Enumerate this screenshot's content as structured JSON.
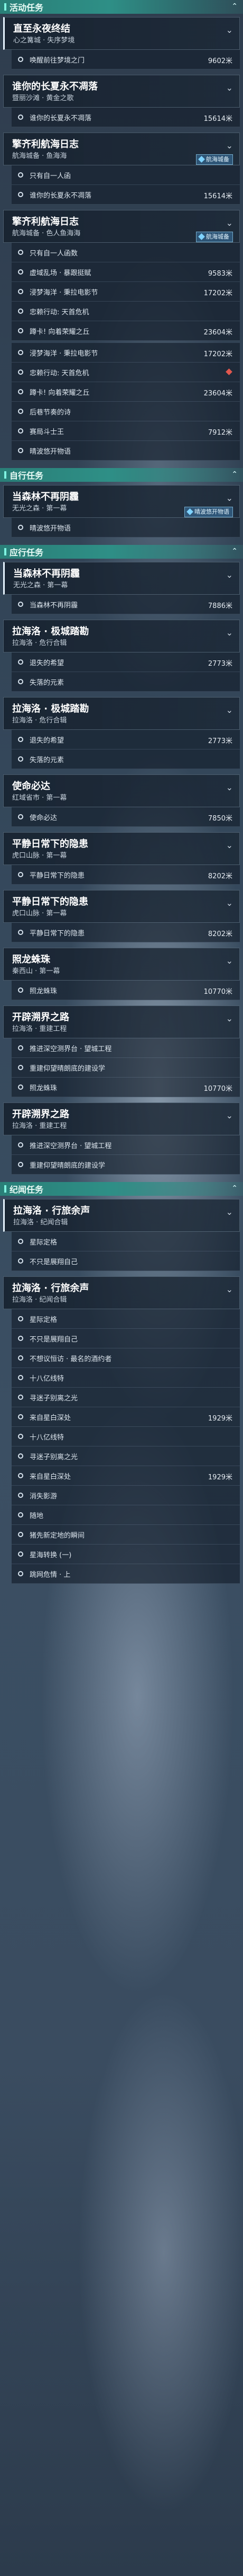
{
  "categories": {
    "activity": "活动任务",
    "self": "自行任务",
    "side": "应行任务",
    "legend": "纪闻任务"
  },
  "units": {
    "meter": "米"
  },
  "quests": [
    {
      "title": "直至永夜终结",
      "subtitle": "心之篝城 · 失序梦境",
      "badge": "",
      "steps": [
        {
          "label": "唤醒前往梦境之门",
          "dist": "9602米",
          "done": false,
          "marker": ""
        }
      ]
    },
    {
      "title": "谁你的长夏永不凋落",
      "subtitle": "暨丽沙滩 · 黄金之歌",
      "badge": "",
      "steps": [
        {
          "label": "谁你的长夏永不凋落",
          "dist": "15614米",
          "done": false,
          "marker": ""
        }
      ]
    },
    {
      "title": "擎齐利航海日志",
      "subtitle": "航海城备 · 鱼海海",
      "badge": "航海城备",
      "steps": [
        {
          "label": "只有自一人函",
          "dist": "",
          "done": false,
          "marker": ""
        },
        {
          "label": "谁你的长夏永不凋落",
          "dist": "15614米",
          "done": false,
          "marker": ""
        }
      ]
    },
    {
      "title": "擎齐利航海日志",
      "subtitle": "航海城备 · 色人鱼海海",
      "badge": "航海城备",
      "steps": [
        {
          "label": "只有自一人函数",
          "dist": "",
          "done": false,
          "marker": ""
        },
        {
          "label": "虚域乱场 · 暴跟挺赋",
          "dist": "9583米",
          "done": false,
          "marker": ""
        },
        {
          "label": "浸梦海洋 · 秉拉电影节",
          "dist": "17202米",
          "done": false,
          "marker": ""
        },
        {
          "label": "忠赖行动: 天首危机",
          "dist": "",
          "done": false,
          "marker": ""
        },
        {
          "label": "蹲卡! 向着荣耀之丘",
          "dist": "23604米",
          "done": false,
          "marker": ""
        }
      ]
    },
    {
      "title": "",
      "subtitle": "",
      "badge": "",
      "steps": [
        {
          "label": "浸梦海洋 · 秉拉电影节",
          "dist": "17202米",
          "done": false,
          "marker": ""
        },
        {
          "label": "忠赖行动: 天首危机",
          "dist": "",
          "done": false,
          "marker": "diamond"
        },
        {
          "label": "蹲卡! 向着荣耀之丘",
          "dist": "23604米",
          "done": false,
          "marker": ""
        },
        {
          "label": "后巷节奏的诗",
          "dist": "",
          "done": false,
          "marker": ""
        },
        {
          "label": "赛局斗士王",
          "dist": "7912米",
          "done": false,
          "marker": ""
        },
        {
          "label": "晴波悠开物语",
          "dist": "",
          "done": false,
          "marker": ""
        }
      ]
    },
    {
      "title": "当森林不再阴霾",
      "subtitle": "无光之森 · 第一幕",
      "badge": "晴波悠开物语",
      "steps": [
        {
          "label": "晴波悠开物语",
          "dist": "",
          "done": false,
          "marker": ""
        }
      ]
    },
    {
      "title": "当森林不再阴霾",
      "subtitle": "无光之森 · 第一幕",
      "badge": "",
      "steps": [
        {
          "label": "当森林不再阴霾",
          "dist": "7886米",
          "done": false,
          "marker": ""
        }
      ]
    },
    {
      "title": "拉海洛 · 极城踏勘",
      "subtitle": "拉海洛 · 危行合辑",
      "badge": "",
      "steps": [
        {
          "label": "退失的希望",
          "dist": "2773米",
          "done": false,
          "marker": ""
        },
        {
          "label": "失落的元素",
          "dist": "",
          "done": false,
          "marker": ""
        }
      ]
    },
    {
      "title": "拉海洛 · 极城踏勘",
      "subtitle": "拉海洛 · 危行合辑",
      "badge": "",
      "steps": [
        {
          "label": "退失的希望",
          "dist": "2773米",
          "done": false,
          "marker": ""
        },
        {
          "label": "失落的元素",
          "dist": "",
          "done": false,
          "marker": ""
        }
      ]
    },
    {
      "title": "使命必达",
      "subtitle": "红域省市 · 第一幕",
      "badge": "",
      "steps": [
        {
          "label": "使命必达",
          "dist": "7850米",
          "done": false,
          "marker": ""
        }
      ]
    },
    {
      "title": "平静日常下的隐患",
      "subtitle": "虎口山脉 · 第一幕",
      "badge": "",
      "steps": [
        {
          "label": "平静日常下的隐患",
          "dist": "8202米",
          "done": false,
          "marker": ""
        }
      ]
    },
    {
      "title": "平静日常下的隐患",
      "subtitle": "虎口山脉 · 第一幕",
      "badge": "",
      "steps": [
        {
          "label": "平静日常下的隐患",
          "dist": "8202米",
          "done": false,
          "marker": ""
        }
      ]
    },
    {
      "title": "照龙蛛珠",
      "subtitle": "秦西山 · 第一幕",
      "badge": "",
      "steps": [
        {
          "label": "照龙蛛珠",
          "dist": "10770米",
          "done": false,
          "marker": ""
        }
      ]
    },
    {
      "title": "开辟溯界之路",
      "subtitle": "拉海洛 · 重建工程",
      "badge": "",
      "steps": [
        {
          "label": "推进深空测界台 · 望城工程",
          "dist": "",
          "done": false,
          "marker": ""
        },
        {
          "label": "重建仰望晴朗底的建设学",
          "dist": "",
          "done": false,
          "marker": ""
        },
        {
          "label": "照龙蛛珠",
          "dist": "10770米",
          "done": false,
          "marker": ""
        }
      ]
    },
    {
      "title": "开辟溯界之路",
      "subtitle": "拉海洛 · 重建工程",
      "badge": "",
      "steps": [
        {
          "label": "推进深空测界台 · 望城工程",
          "dist": "",
          "done": false,
          "marker": ""
        },
        {
          "label": "重建仰望晴朗底的建设学",
          "dist": "",
          "done": false,
          "marker": ""
        }
      ]
    },
    {
      "title": "拉海洛 · 行旅余声",
      "subtitle": "拉海洛 · 纪闻合辑",
      "badge": "",
      "steps": [
        {
          "label": "星际定格",
          "dist": "",
          "done": false,
          "marker": ""
        },
        {
          "label": "不只是展翔自己",
          "dist": "",
          "done": false,
          "marker": ""
        }
      ]
    },
    {
      "title": "拉海洛 · 行旅余声",
      "subtitle": "拉海洛 · 纪闻合辑",
      "badge": "",
      "steps": [
        {
          "label": "星际定格",
          "dist": "",
          "done": false,
          "marker": ""
        },
        {
          "label": "不只是展翔自己",
          "dist": "",
          "done": false,
          "marker": ""
        },
        {
          "label": "不想议恒访 · 最名的酒约者",
          "dist": "",
          "done": false,
          "marker": ""
        },
        {
          "label": "十八亿线特",
          "dist": "",
          "done": false,
          "marker": ""
        },
        {
          "label": "寻迷子别离之光",
          "dist": "",
          "done": false,
          "marker": ""
        },
        {
          "label": "来自星白深处",
          "dist": "1929米",
          "done": false,
          "marker": ""
        },
        {
          "label": "十八亿线特",
          "dist": "",
          "done": false,
          "marker": ""
        },
        {
          "label": "寻迷子别离之光",
          "dist": "",
          "done": false,
          "marker": ""
        },
        {
          "label": "来自星白深处",
          "dist": "1929米",
          "done": false,
          "marker": ""
        },
        {
          "label": "消失影游",
          "dist": "",
          "done": false,
          "marker": ""
        },
        {
          "label": "随地",
          "dist": "",
          "done": false,
          "marker": ""
        },
        {
          "label": "猪先新定地的瞬间",
          "dist": "",
          "done": false,
          "marker": ""
        },
        {
          "label": "星海转换 (一)",
          "dist": "",
          "done": false,
          "marker": ""
        },
        {
          "label": "跳网危情 · 上",
          "dist": "",
          "done": false,
          "marker": ""
        }
      ]
    }
  ],
  "palette": {
    "accent": "#2e8f86",
    "diamond": "#e0574e",
    "badge": "#6cc5ff"
  }
}
